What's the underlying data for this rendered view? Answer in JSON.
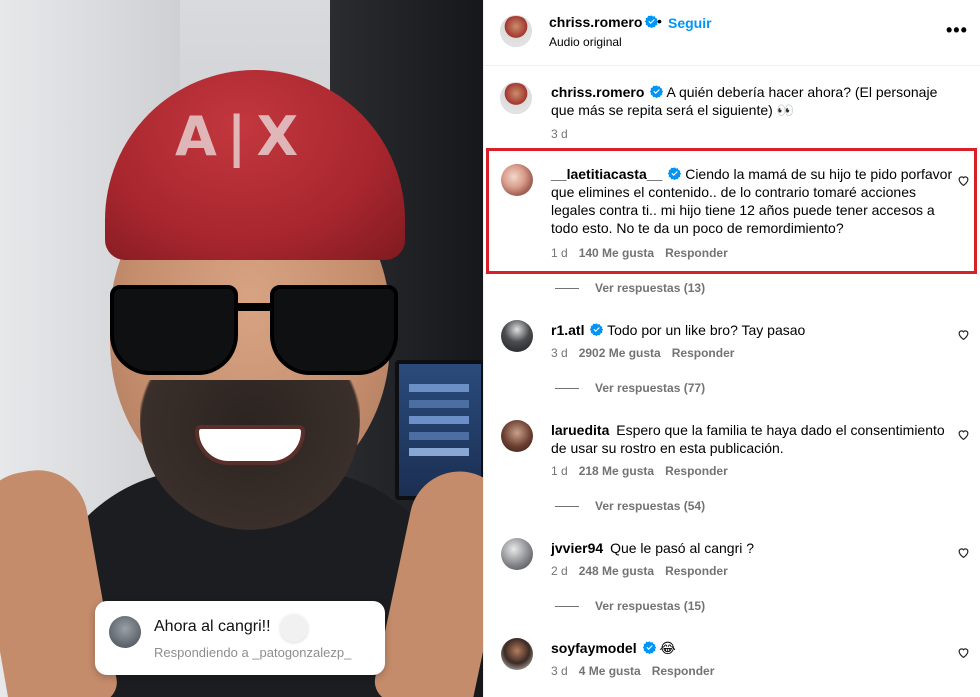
{
  "video": {
    "cap_logo": "A|X",
    "reply_card": {
      "title": "Ahora al cangri!!",
      "subtitle": "Respondiendo a _patogonzalezp_"
    }
  },
  "header": {
    "username": "chriss.romero",
    "separator": "•",
    "follow_label": "Seguir",
    "audio_label": "Audio original",
    "more_label": "•••"
  },
  "caption": {
    "username": "chriss.romero",
    "text": "A quién debería hacer ahora? (El personaje que más se repita será el siguiente) 👀",
    "time": "3 d"
  },
  "comments": [
    {
      "username": "__laetitiacasta__",
      "verified": true,
      "text": "Ciendo la mamá de su hijo te pido porfavor que elimines el contenido.. de lo contrario tomaré acciones legales contra ti.. mi hijo tiene 12 años puede tener accesos a todo esto. No te da un poco de remordimiento?",
      "time": "1 d",
      "likes": "140 Me gusta",
      "reply_label": "Responder",
      "view_replies": "Ver respuestas (13)"
    },
    {
      "username": "r1.atl",
      "verified": true,
      "text": "Todo por un like bro? Tay pasao",
      "time": "3 d",
      "likes": "2902 Me gusta",
      "reply_label": "Responder",
      "view_replies": "Ver respuestas (77)"
    },
    {
      "username": "laruedita",
      "verified": false,
      "text": "Espero que la familia te haya dado el consentimiento de usar su rostro en esta publicación.",
      "time": "1 d",
      "likes": "218 Me gusta",
      "reply_label": "Responder",
      "view_replies": "Ver respuestas (54)"
    },
    {
      "username": "jvvier94",
      "verified": false,
      "text": "Que le pasó al cangri ?",
      "time": "2 d",
      "likes": "248 Me gusta",
      "reply_label": "Responder",
      "view_replies": "Ver respuestas (15)"
    },
    {
      "username": "soyfaymodel",
      "verified": true,
      "text": "😂",
      "time": "3 d",
      "likes": "4 Me gusta",
      "reply_label": "Responder"
    }
  ],
  "colors": {
    "accent": "#0095f6",
    "verified": "#0095f6",
    "highlight_border": "#d92029",
    "meta_text": "#737373"
  },
  "icons": [
    "verified-badge-icon",
    "heart-icon",
    "more-options-icon"
  ]
}
